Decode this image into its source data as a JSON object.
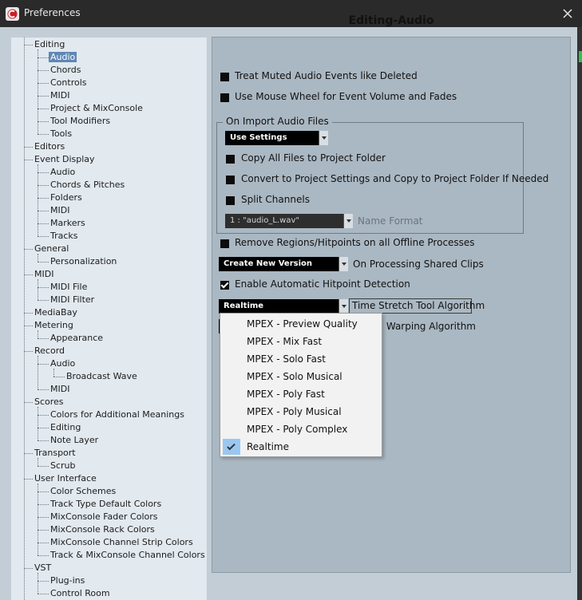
{
  "window": {
    "title": "Preferences"
  },
  "page_title": "Editing-Audio",
  "tree": [
    {
      "label": "Editing",
      "level": 0
    },
    {
      "label": "Audio",
      "level": 1,
      "selected": true
    },
    {
      "label": "Chords",
      "level": 1
    },
    {
      "label": "Controls",
      "level": 1
    },
    {
      "label": "MIDI",
      "level": 1
    },
    {
      "label": "Project & MixConsole",
      "level": 1
    },
    {
      "label": "Tool Modifiers",
      "level": 1
    },
    {
      "label": "Tools",
      "level": 1
    },
    {
      "label": "Editors",
      "level": 0
    },
    {
      "label": "Event Display",
      "level": 0
    },
    {
      "label": "Audio",
      "level": 1
    },
    {
      "label": "Chords & Pitches",
      "level": 1
    },
    {
      "label": "Folders",
      "level": 1
    },
    {
      "label": "MIDI",
      "level": 1
    },
    {
      "label": "Markers",
      "level": 1
    },
    {
      "label": "Tracks",
      "level": 1
    },
    {
      "label": "General",
      "level": 0
    },
    {
      "label": "Personalization",
      "level": 1
    },
    {
      "label": "MIDI",
      "level": 0
    },
    {
      "label": "MIDI File",
      "level": 1
    },
    {
      "label": "MIDI Filter",
      "level": 1
    },
    {
      "label": "MediaBay",
      "level": 0
    },
    {
      "label": "Metering",
      "level": 0
    },
    {
      "label": "Appearance",
      "level": 1
    },
    {
      "label": "Record",
      "level": 0
    },
    {
      "label": "Audio",
      "level": 1
    },
    {
      "label": "Broadcast Wave",
      "level": 2
    },
    {
      "label": "MIDI",
      "level": 1
    },
    {
      "label": "Scores",
      "level": 0
    },
    {
      "label": "Colors for Additional Meanings",
      "level": 1
    },
    {
      "label": "Editing",
      "level": 1
    },
    {
      "label": "Note Layer",
      "level": 1
    },
    {
      "label": "Transport",
      "level": 0
    },
    {
      "label": "Scrub",
      "level": 1
    },
    {
      "label": "User Interface",
      "level": 0
    },
    {
      "label": "Color Schemes",
      "level": 1
    },
    {
      "label": "Track Type Default Colors",
      "level": 1
    },
    {
      "label": "MixConsole Fader Colors",
      "level": 1
    },
    {
      "label": "MixConsole Rack Colors",
      "level": 1
    },
    {
      "label": "MixConsole Channel Strip Colors",
      "level": 1
    },
    {
      "label": "Track & MixConsole Channel Colors",
      "level": 1
    },
    {
      "label": "VST",
      "level": 0
    },
    {
      "label": "Plug-ins",
      "level": 1
    },
    {
      "label": "Control Room",
      "level": 1
    }
  ],
  "options": {
    "treat_muted": {
      "label": "Treat Muted Audio Events like Deleted",
      "checked": false
    },
    "mouse_wheel": {
      "label": "Use Mouse Wheel for Event Volume and Fades",
      "checked": false
    },
    "remove_regions": {
      "label": "Remove Regions/Hitpoints on all Offline Processes",
      "checked": false
    },
    "enable_hitpoint": {
      "label": "Enable Automatic Hitpoint Detection",
      "checked": true
    }
  },
  "import_group": {
    "legend": "On Import Audio Files",
    "mode_dropdown": "Use Settings",
    "copy_all": {
      "label": "Copy All Files to Project Folder",
      "checked": false
    },
    "convert": {
      "label": "Convert to Project Settings and Copy to Project Folder If Needed",
      "checked": false
    },
    "split": {
      "label": "Split Channels",
      "checked": false
    },
    "name_format_value": "1 : \"audio_L.wav\"",
    "name_format_label": "Name Format"
  },
  "shared_clips": {
    "dropdown": "Create New Version",
    "label": "On Processing Shared Clips"
  },
  "time_stretch": {
    "dropdown": "Realtime",
    "label": "Time Stretch Tool Algorithm"
  },
  "warping": {
    "label_partial": ": Warping Algorithm"
  },
  "menu": {
    "items": [
      {
        "label": "MPEX - Preview Quality",
        "checked": false
      },
      {
        "label": "MPEX - Mix Fast",
        "checked": false
      },
      {
        "label": "MPEX - Solo Fast",
        "checked": false
      },
      {
        "label": "MPEX - Solo Musical",
        "checked": false
      },
      {
        "label": "MPEX - Poly Fast",
        "checked": false
      },
      {
        "label": "MPEX - Poly Musical",
        "checked": false
      },
      {
        "label": "MPEX - Poly Complex",
        "checked": false
      },
      {
        "label": "Realtime",
        "checked": true
      }
    ]
  },
  "colors": {
    "dialog_bg": "#c2cdd6",
    "tree_bg": "#e2e9ef",
    "panel_bg": "#aab8c3",
    "selection": "#5f87b4",
    "menu_check": "#99c8ef",
    "accent_green": "#2ec34b"
  }
}
